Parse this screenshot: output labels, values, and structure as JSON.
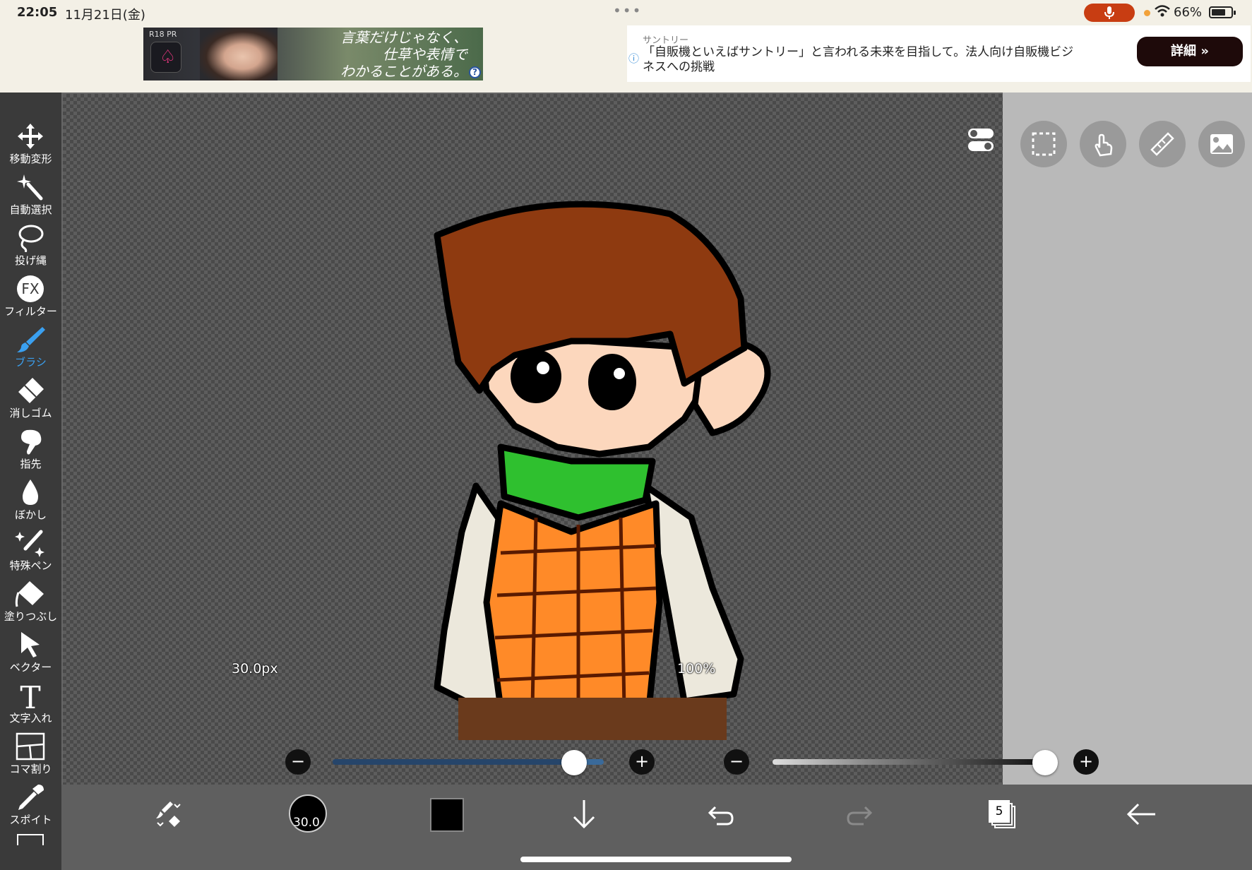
{
  "status_bar": {
    "time": "22:05",
    "date": "11月21日(金)",
    "dots": "•••",
    "battery": "66%",
    "mic_color": "#c83d12"
  },
  "ads": {
    "left": {
      "tag": "R18 PR",
      "copy": [
        "言葉だけじゃなく、",
        "仕草や表情で",
        "わかることがある。"
      ],
      "help": "?"
    },
    "right": {
      "advertiser": "サントリー",
      "text": "「自販機といえばサントリー」と言われる未来を目指して。法人向け自販機ビジネスへの挑戦",
      "button": "詳細 »",
      "info_icon": "ⓘ"
    }
  },
  "toolbar": {
    "active_color": "#3aa0f0",
    "tools": [
      {
        "label": "移動変形",
        "icon": "move-icon"
      },
      {
        "label": "自動選択",
        "icon": "magic-wand-icon"
      },
      {
        "label": "投げ縄",
        "icon": "lasso-icon"
      },
      {
        "label": "フィルター",
        "icon": "fx-icon"
      },
      {
        "label": "ブラシ",
        "icon": "brush-icon",
        "active": true
      },
      {
        "label": "消しゴム",
        "icon": "eraser-icon"
      },
      {
        "label": "指先",
        "icon": "smudge-icon"
      },
      {
        "label": "ぼかし",
        "icon": "blur-drop-icon"
      },
      {
        "label": "特殊ペン",
        "icon": "special-pen-icon"
      },
      {
        "label": "塗りつぶし",
        "icon": "bucket-fill-icon"
      },
      {
        "label": "ベクター",
        "icon": "vector-cursor-icon"
      },
      {
        "label": "文字入れ",
        "icon": "text-icon"
      },
      {
        "label": "コマ割り",
        "icon": "frame-divider-icon"
      },
      {
        "label": "スポイト",
        "icon": "eyedropper-icon"
      }
    ],
    "fx_glyph": "FX",
    "text_glyph": "T"
  },
  "sliders": {
    "size_label": "30.0px",
    "size_value_fraction": 0.89,
    "opacity_label": "100%",
    "opacity_value_fraction": 1.0,
    "minus": "−",
    "plus": "+"
  },
  "bottom_bar": {
    "brush_size": "30.0",
    "current_color": "#000000",
    "layer_count": "5"
  },
  "colors": {
    "canvas_bg": "#5d5d5d",
    "panel_bg": "#b9b9b9",
    "toolbar_bg": "#3a3a3a",
    "hair": "#8e3a10",
    "skin": "#fcd7bd",
    "scarf": "#2fc02f",
    "vest": "#ff8a28",
    "shirt": "#ece8dc"
  }
}
